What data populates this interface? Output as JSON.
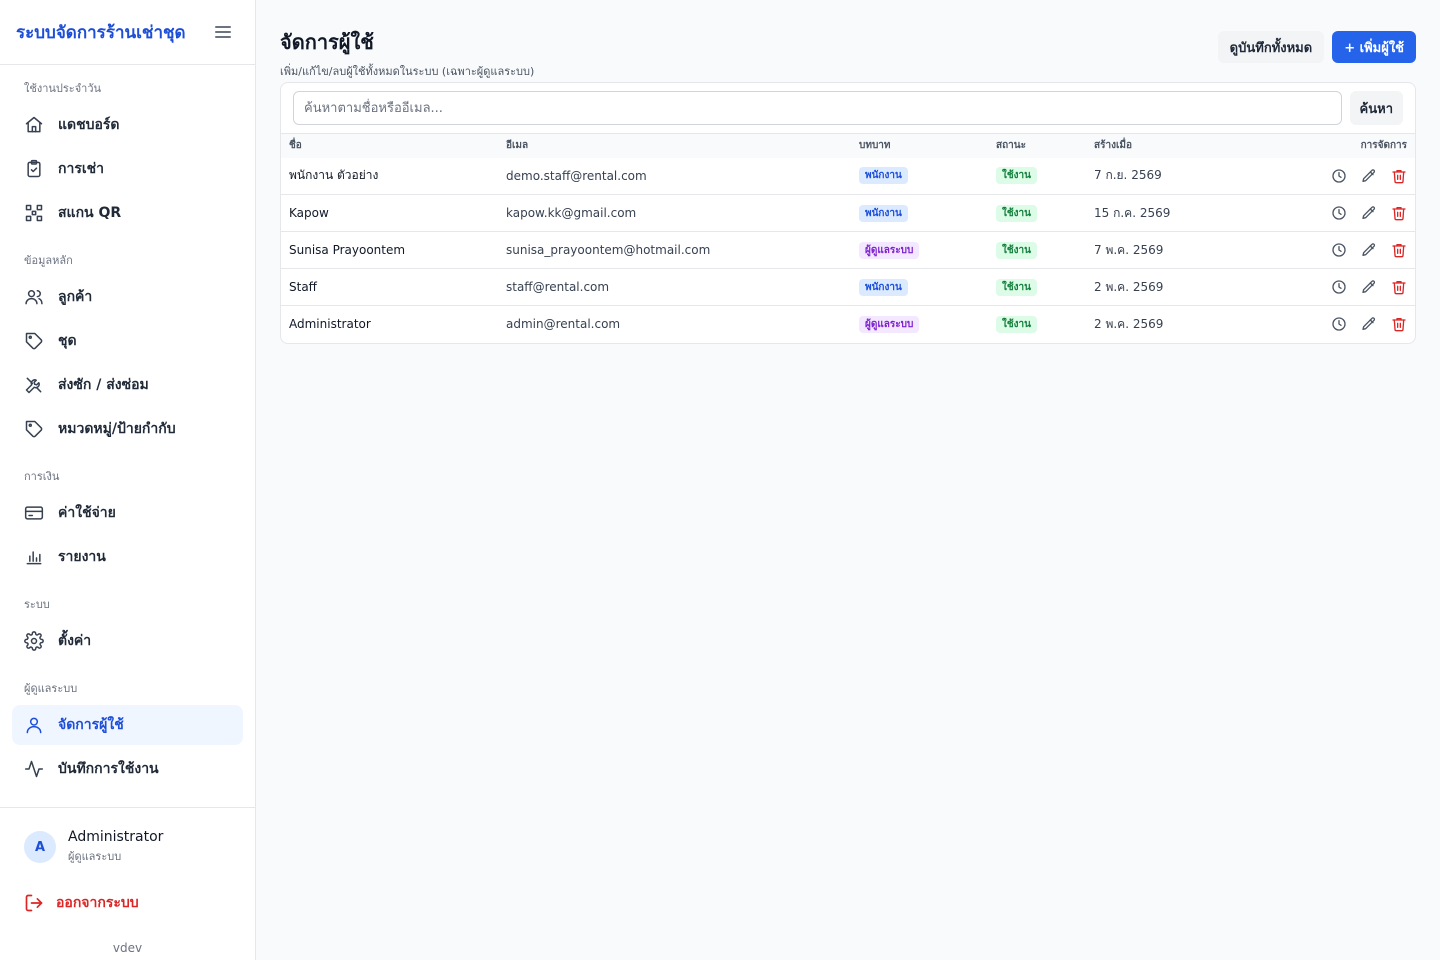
{
  "app": {
    "title": "ระบบจัดการร้านเช่าชุด",
    "version": "vdev"
  },
  "sidebar": {
    "sections": [
      {
        "label": "ใช้งานประจำวัน",
        "items": [
          {
            "label": "แดชบอร์ด",
            "icon": "home-icon"
          },
          {
            "label": "การเช่า",
            "icon": "clipboard-icon"
          },
          {
            "label": "สแกน QR",
            "icon": "qr-icon"
          }
        ]
      },
      {
        "label": "ข้อมูลหลัก",
        "items": [
          {
            "label": "ลูกค้า",
            "icon": "users-icon"
          },
          {
            "label": "ชุด",
            "icon": "tag-icon"
          },
          {
            "label": "ส่งซัก / ส่งซ่อม",
            "icon": "tools-icon"
          },
          {
            "label": "หมวดหมู่/ป้ายกำกับ",
            "icon": "tag-icon"
          }
        ]
      },
      {
        "label": "การเงิน",
        "items": [
          {
            "label": "ค่าใช้จ่าย",
            "icon": "credit-card-icon"
          },
          {
            "label": "รายงาน",
            "icon": "bar-chart-icon"
          }
        ]
      },
      {
        "label": "ระบบ",
        "items": [
          {
            "label": "ตั้งค่า",
            "icon": "gear-icon"
          }
        ]
      },
      {
        "label": "ผู้ดูแลระบบ",
        "items": [
          {
            "label": "จัดการผู้ใช้",
            "icon": "user-icon",
            "active": true
          },
          {
            "label": "บันทึกการใช้งาน",
            "icon": "activity-icon"
          }
        ]
      }
    ],
    "user": {
      "initial": "A",
      "name": "Administrator",
      "role": "ผู้ดูแลระบบ"
    },
    "logout_label": "ออกจากระบบ"
  },
  "page": {
    "title": "จัดการผู้ใช้",
    "subtitle": "เพิ่ม/แก้ไข/ลบผู้ใช้ทั้งหมดในระบบ (เฉพาะผู้ดูแลระบบ)",
    "view_logs_label": "ดูบันทึกทั้งหมด",
    "add_user_label": "+ เพิ่มผู้ใช้"
  },
  "search": {
    "placeholder": "ค้นหาตามชื่อหรืออีเมล...",
    "value": "",
    "button_label": "ค้นหา"
  },
  "table": {
    "headers": {
      "name": "ชื่อ",
      "email": "อีเมล",
      "role": "บทบาท",
      "status": "สถานะ",
      "created": "สร้างเมื่อ",
      "actions": "การจัดการ"
    },
    "rows": [
      {
        "name": "พนักงาน ตัวอย่าง",
        "email": "demo.staff@rental.com",
        "role": "พนักงาน",
        "role_type": "staff",
        "status": "ใช้งาน",
        "created": "7 ก.ย. 2569"
      },
      {
        "name": "Kapow",
        "email": "kapow.kk@gmail.com",
        "role": "พนักงาน",
        "role_type": "staff",
        "status": "ใช้งาน",
        "created": "15 ก.ค. 2569"
      },
      {
        "name": "Sunisa Prayoontem",
        "email": "sunisa_prayoontem@hotmail.com",
        "role": "ผู้ดูแลระบบ",
        "role_type": "admin",
        "status": "ใช้งาน",
        "created": "7 พ.ค. 2569"
      },
      {
        "name": "Staff",
        "email": "staff@rental.com",
        "role": "พนักงาน",
        "role_type": "staff",
        "status": "ใช้งาน",
        "created": "2 พ.ค. 2569"
      },
      {
        "name": "Administrator",
        "email": "admin@rental.com",
        "role": "ผู้ดูแลระบบ",
        "role_type": "admin",
        "status": "ใช้งาน",
        "created": "2 พ.ค. 2569"
      }
    ]
  },
  "colors": {
    "brand": "#1d4ed8",
    "primary_button": "#2563eb",
    "danger": "#dc2626",
    "active_nav_bg": "#eff6ff"
  }
}
